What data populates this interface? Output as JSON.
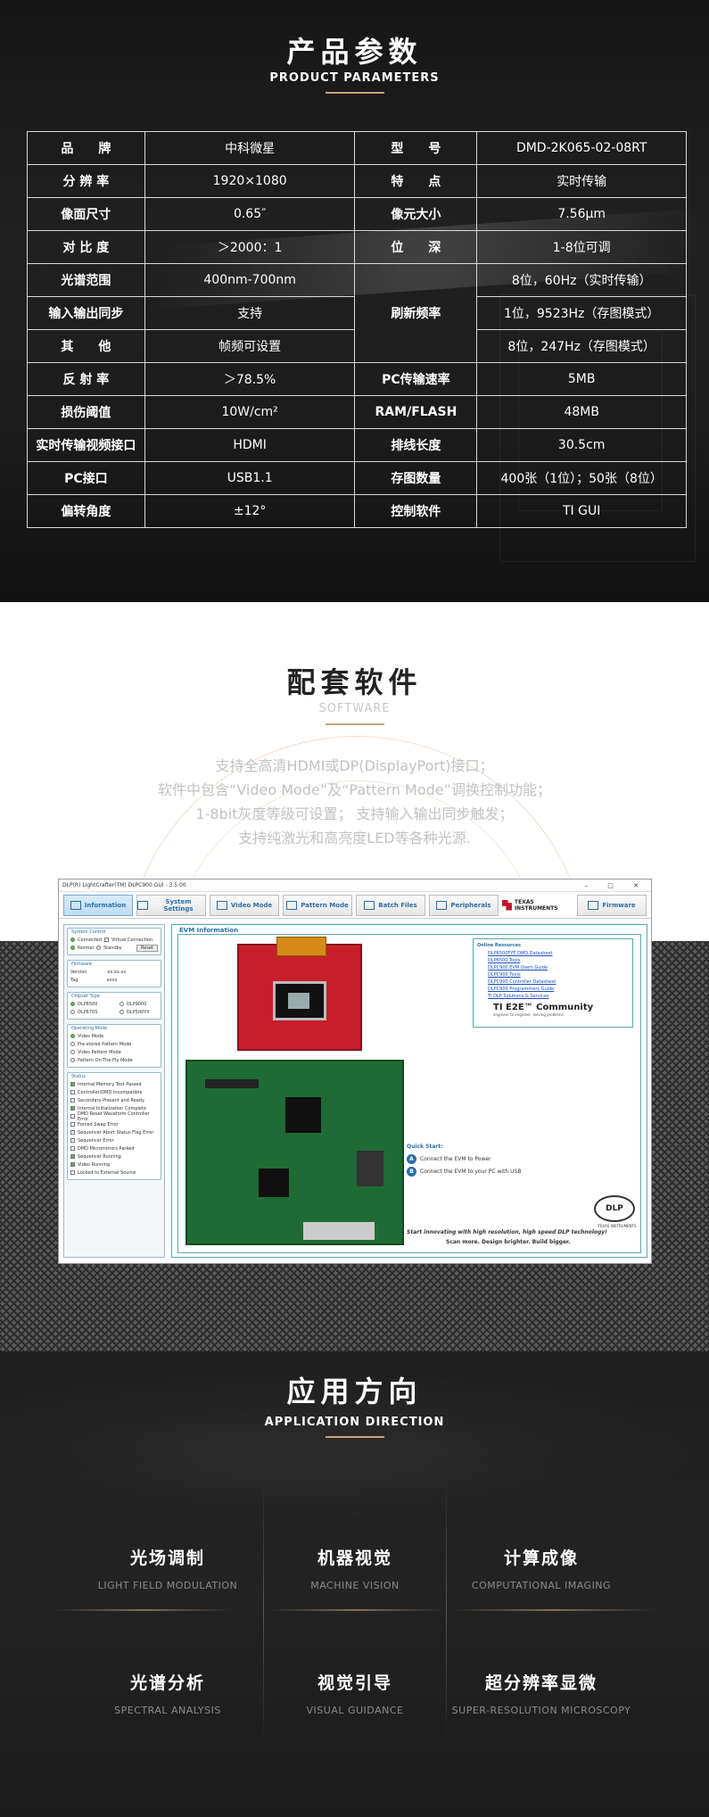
{
  "params": {
    "title": "产品参数",
    "subtitle": "PRODUCT PARAMETERS",
    "rows": [
      {
        "k1": "品　　牌",
        "v1": "中科微星",
        "k2": "型　　号",
        "v2": "DMD-2K065-02-08RT"
      },
      {
        "k1": "分 辨 率",
        "v1": "1920×1080",
        "k2": "特　　点",
        "v2": "实时传输"
      },
      {
        "k1": "像面尺寸",
        "v1": "0.65″",
        "k2": "像元大小",
        "v2": "7.56μm"
      },
      {
        "k1": "对 比 度",
        "v1": "＞2000：1",
        "k2": "位　　深",
        "v2": "1-8位可调"
      },
      {
        "k1": "光谱范围",
        "v1": "400nm-700nm",
        "v2": "8位，60Hz（实时传输）"
      },
      {
        "k1": "输入输出同步",
        "v1": "支持",
        "k2": "刷新频率",
        "v2": "1位，9523Hz（存图模式）"
      },
      {
        "k1": "其　　他",
        "v1": "帧频可设置",
        "v2": "8位，247Hz（存图模式）"
      },
      {
        "k1": "反 射 率",
        "v1": "＞78.5%",
        "k2": "PC传输速率",
        "v2": "5MB"
      },
      {
        "k1": "损伤阈值",
        "v1": "10W/cm²",
        "k2": "RAM/FLASH",
        "v2": "48MB"
      },
      {
        "k1": "实时传输视频接口",
        "v1": "HDMI",
        "k2": "排线长度",
        "v2": "30.5cm"
      },
      {
        "k1": "PC接口",
        "v1": "USB1.1",
        "k2": "存图数量",
        "v2": "400张（1位）；50张（8位）"
      },
      {
        "k1": "偏转角度",
        "v1": "±12°",
        "k2": "控制软件",
        "v2": "TI GUI"
      }
    ]
  },
  "software": {
    "title": "配套软件",
    "subtitle": "SOFTWARE",
    "lines": [
      "支持全高清HDMI或DP(DisplayPort)接口；",
      "软件中包含“Video Mode”及“Pattern Mode”调换控制功能；",
      "1-8bit灰度等级可设置；  支持输入输出同步触发；",
      "支持纯激光和高亮度LED等各种光源."
    ],
    "gui": {
      "window_title": "DLP(R) LightCrafter(TM) DLPC900 GUI - 3.5.00",
      "window_controls": "–  □  ✕",
      "tabs": [
        "Information",
        "System Settings",
        "Video Mode",
        "Pattern Mode",
        "Batch Files",
        "Peripherals"
      ],
      "ti_logo": "TEXAS INSTRUMENTS",
      "firmware_tab": "Firmware",
      "system_control": {
        "label": "System Control",
        "connected": "Connected",
        "virtual": "Virtual Connection",
        "normal": "Normal",
        "standby": "Standby",
        "reset": "Reset"
      },
      "firmware": {
        "label": "Firmware",
        "version_label": "Version",
        "version_value": "xx.xx.xx",
        "tag_label": "Tag",
        "tag_value": "xxxx"
      },
      "chipset": {
        "label": "Chipset Type",
        "opts": [
          "DLP6500",
          "DLP9000",
          "DLP670S",
          "DLP500YX"
        ]
      },
      "operating": {
        "label": "Operating Mode",
        "opts": [
          "Video Mode",
          "Pre-stored Pattern Mode",
          "Video Pattern Mode",
          "Pattern On-The-Fly Mode"
        ]
      },
      "status": {
        "label": "Status",
        "items": [
          "Internal Memory Test Passed",
          "Controller/DMD Incompatible",
          "Secondary Present and Ready",
          "Internal Initialization Complete",
          "DMD Reset Waveform Controller Error",
          "Forced Swap Error",
          "Sequencer Abort Status Flag Error",
          "Sequencer Error",
          "DMD Micromirrors Parked",
          "Sequencer Running",
          "Video Running",
          "Locked to External Source"
        ]
      },
      "evm_label": "EVM Information",
      "resources": {
        "title": "Online Resources",
        "links": [
          "DLP6500FYE DMD Datasheet",
          "DLP6500 Tools",
          "DLPC900 EVM Users Guide",
          "DLPC900 Tools",
          "DLPC900 Controller Datasheet",
          "DLPC900 Programmers Guide",
          "TI DLP Solutions & Services"
        ],
        "community": "TI E2E™ Community",
        "community_sub": "engineer to engineer, solving problems"
      },
      "quick_start": {
        "title": "Quick Start:",
        "a": "Connect the EVM to Power",
        "b": "Connect the EVM to your PC with USB"
      },
      "dlp_logo": "DLP",
      "dlp_sub": "TEXAS INSTRUMENTS",
      "tagline1": "Start innovating with high resolution, high speed DLP technology!",
      "tagline2": "Scan more.   Design brighter.   Build bigger."
    }
  },
  "applications": {
    "title": "应用方向",
    "subtitle": "APPLICATION DIRECTION",
    "items": [
      {
        "cn": "光场调制",
        "en": "LIGHT FIELD MODULATION"
      },
      {
        "cn": "机器视觉",
        "en": "MACHINE VISION"
      },
      {
        "cn": "计算成像",
        "en": "COMPUTATIONAL IMAGING"
      },
      {
        "cn": "光谱分析",
        "en": "SPECTRAL  ANALYSIS"
      },
      {
        "cn": "视觉引导",
        "en": "VISUAL GUIDANCE"
      },
      {
        "cn": "超分辨率显微",
        "en": "SUPER-RESOLUTION MICROSCOPY"
      }
    ]
  }
}
